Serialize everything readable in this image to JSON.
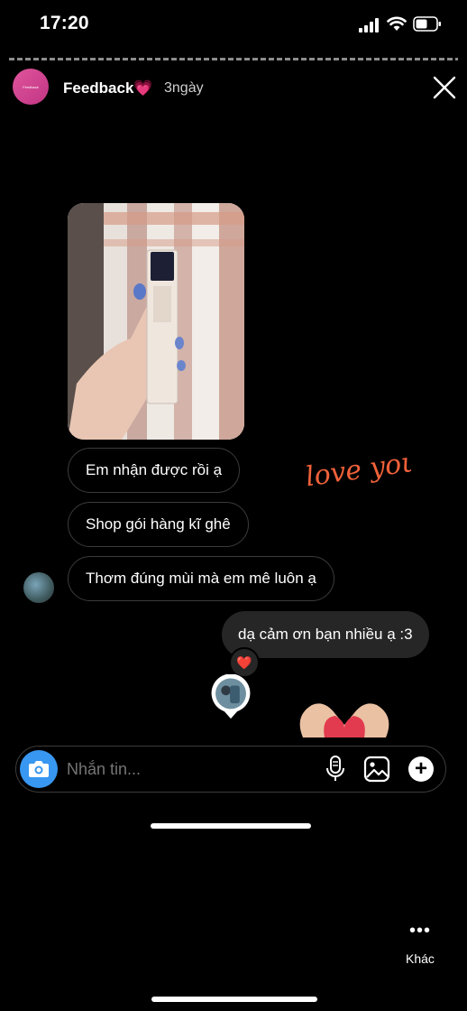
{
  "status_bar": {
    "time": "17:20"
  },
  "story": {
    "account_name": "Feedback💗",
    "time_ago": "3ngày",
    "avatar_text": "Feedback"
  },
  "chat": {
    "messages_received": [
      "Em nhận được rồi ạ",
      "Shop gói hàng kĩ ghê",
      "Thơm đúng mùi mà em mê luôn ạ"
    ],
    "message_sent": "dạ cảm ơn bạn nhiều ạ :3",
    "reaction": "❤️"
  },
  "stickers": {
    "love_text": "love you!"
  },
  "composer": {
    "placeholder": "Nhắn tin..."
  },
  "menu": {
    "more_label": "Khác",
    "more_dots": "•••"
  },
  "colors": {
    "accent": "#3897f0",
    "sticker": "#f0613a",
    "bubble_sent": "#262626"
  }
}
